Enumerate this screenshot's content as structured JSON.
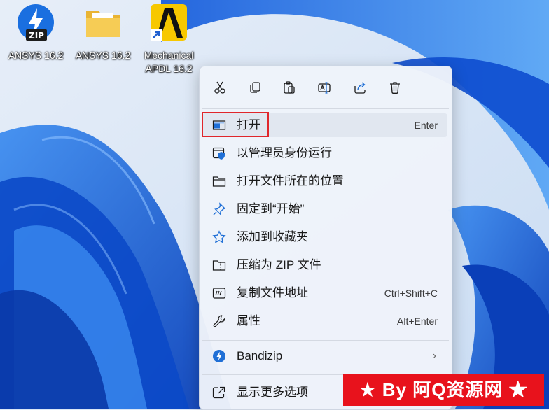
{
  "desktop": {
    "icons": [
      {
        "label": "ANSYS 16.2",
        "icon": "zip-archive-icon"
      },
      {
        "label": "ANSYS 16.2",
        "icon": "folder-icon"
      },
      {
        "label": "Mechanical\nAPDL 16.2",
        "icon": "apdl-shortcut-icon"
      }
    ]
  },
  "context_menu": {
    "toolbar": [
      {
        "name": "cut",
        "icon": "scissors-icon"
      },
      {
        "name": "copy",
        "icon": "copy-icon"
      },
      {
        "name": "paste",
        "icon": "paste-icon"
      },
      {
        "name": "rename",
        "icon": "rename-icon"
      },
      {
        "name": "share",
        "icon": "share-icon"
      },
      {
        "name": "delete",
        "icon": "trash-icon"
      }
    ],
    "items": [
      {
        "label": "打开",
        "shortcut": "Enter",
        "icon": "open-window-icon"
      },
      {
        "label": "以管理员身份运行",
        "shortcut": "",
        "icon": "admin-shield-icon"
      },
      {
        "label": "打开文件所在的位置",
        "shortcut": "",
        "icon": "folder-outline-icon"
      },
      {
        "label": "固定到“开始”",
        "shortcut": "",
        "icon": "pin-icon"
      },
      {
        "label": "添加到收藏夹",
        "shortcut": "",
        "icon": "star-icon"
      },
      {
        "label": "压缩为 ZIP 文件",
        "shortcut": "",
        "icon": "zip-folder-icon"
      },
      {
        "label": "复制文件地址",
        "shortcut": "Ctrl+Shift+C",
        "icon": "path-copy-icon"
      },
      {
        "label": "属性",
        "shortcut": "Alt+Enter",
        "icon": "wrench-icon"
      },
      {
        "label": "Bandizip",
        "shortcut": "",
        "icon": "bandizip-icon",
        "submenu": "›"
      },
      {
        "label": "显示更多选项",
        "shortcut": "",
        "icon": "more-options-icon"
      }
    ]
  },
  "watermark": {
    "text": "★ By 阿Q资源网 ★"
  },
  "colors": {
    "highlight_border": "#e0262b",
    "watermark_bg": "#e8121c",
    "accent": "#1f6fd6"
  }
}
